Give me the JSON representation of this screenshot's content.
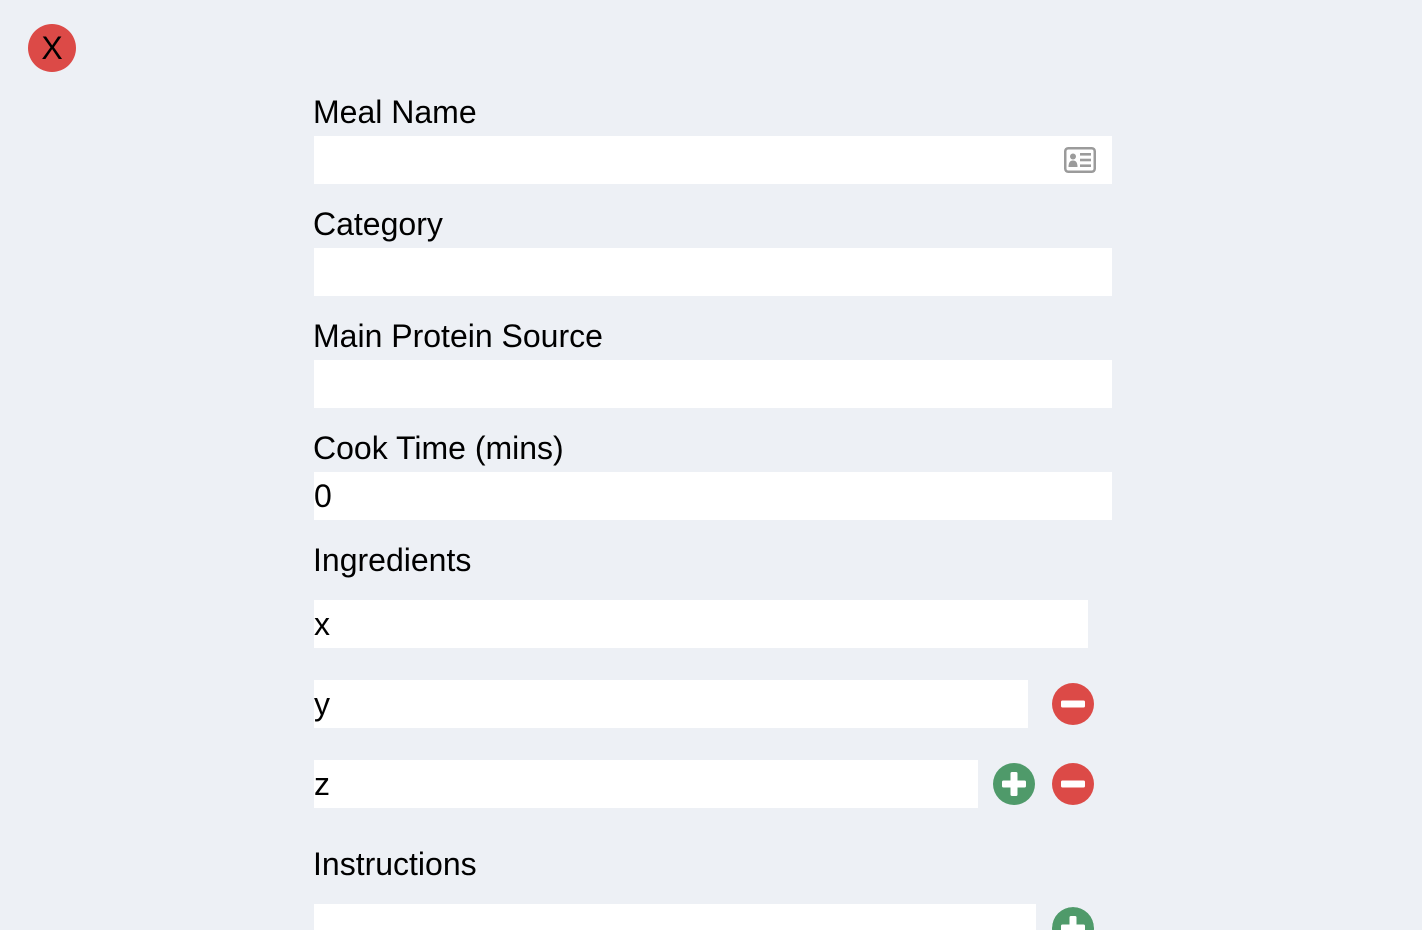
{
  "close_button": {
    "label": "X"
  },
  "form": {
    "meal_name": {
      "label": "Meal Name",
      "value": ""
    },
    "category": {
      "label": "Category",
      "value": ""
    },
    "main_protein_source": {
      "label": "Main Protein Source",
      "value": ""
    },
    "cook_time": {
      "label": "Cook Time (mins)",
      "value": "0"
    },
    "ingredients": {
      "label": "Ingredients",
      "items": [
        {
          "value": "x"
        },
        {
          "value": "y"
        },
        {
          "value": "z"
        }
      ]
    },
    "instructions": {
      "label": "Instructions",
      "items": [
        {
          "value": ""
        }
      ]
    }
  },
  "colors": {
    "background": "#edf0f5",
    "remove": "#dc4a47",
    "add": "#4f9a6a",
    "icon_gray": "#9b9b9b"
  },
  "icons": [
    "close-icon",
    "contact-card-icon",
    "minus-circle-icon",
    "plus-circle-icon"
  ]
}
